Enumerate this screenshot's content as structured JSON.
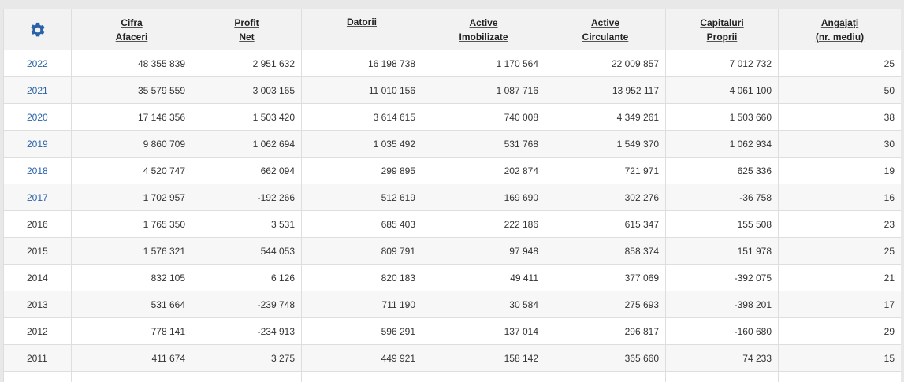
{
  "header": {
    "settings_icon": "gear-icon",
    "accent_color": "#2a62a8",
    "columns": [
      {
        "line1": "Cifra",
        "line2": "Afaceri"
      },
      {
        "line1": "Profit",
        "line2": "Net"
      },
      {
        "line1": "Datorii",
        "line2": ""
      },
      {
        "line1": "Active",
        "line2": "Imobilizate"
      },
      {
        "line1": "Active",
        "line2": "Circulante"
      },
      {
        "line1": "Capitaluri",
        "line2": "Proprii"
      },
      {
        "line1": "Angajați",
        "line2": "(nr. mediu)"
      }
    ]
  },
  "rows": [
    {
      "year": "2022",
      "link": true,
      "values": [
        "48 355 839",
        "2 951 632",
        "16 198 738",
        "1 170 564",
        "22 009 857",
        "7 012 732",
        "25"
      ]
    },
    {
      "year": "2021",
      "link": true,
      "values": [
        "35 579 559",
        "3 003 165",
        "11 010 156",
        "1 087 716",
        "13 952 117",
        "4 061 100",
        "50"
      ]
    },
    {
      "year": "2020",
      "link": true,
      "values": [
        "17 146 356",
        "1 503 420",
        "3 614 615",
        "740 008",
        "4 349 261",
        "1 503 660",
        "38"
      ]
    },
    {
      "year": "2019",
      "link": true,
      "values": [
        "9 860 709",
        "1 062 694",
        "1 035 492",
        "531 768",
        "1 549 370",
        "1 062 934",
        "30"
      ]
    },
    {
      "year": "2018",
      "link": true,
      "values": [
        "4 520 747",
        "662 094",
        "299 895",
        "202 874",
        "721 971",
        "625 336",
        "19"
      ]
    },
    {
      "year": "2017",
      "link": true,
      "values": [
        "1 702 957",
        "-192 266",
        "512 619",
        "169 690",
        "302 276",
        "-36 758",
        "16"
      ]
    },
    {
      "year": "2016",
      "link": false,
      "values": [
        "1 765 350",
        "3 531",
        "685 403",
        "222 186",
        "615 347",
        "155 508",
        "23"
      ]
    },
    {
      "year": "2015",
      "link": false,
      "values": [
        "1 576 321",
        "544 053",
        "809 791",
        "97 948",
        "858 374",
        "151 978",
        "25"
      ]
    },
    {
      "year": "2014",
      "link": false,
      "values": [
        "832 105",
        "6 126",
        "820 183",
        "49 411",
        "377 069",
        "-392 075",
        "21"
      ]
    },
    {
      "year": "2013",
      "link": false,
      "values": [
        "531 664",
        "-239 748",
        "711 190",
        "30 584",
        "275 693",
        "-398 201",
        "17"
      ]
    },
    {
      "year": "2012",
      "link": false,
      "values": [
        "778 141",
        "-234 913",
        "596 291",
        "137 014",
        "296 817",
        "-160 680",
        "29"
      ]
    },
    {
      "year": "2011",
      "link": false,
      "values": [
        "411 674",
        "3 275",
        "449 921",
        "158 142",
        "365 660",
        "74 233",
        "15"
      ]
    }
  ]
}
